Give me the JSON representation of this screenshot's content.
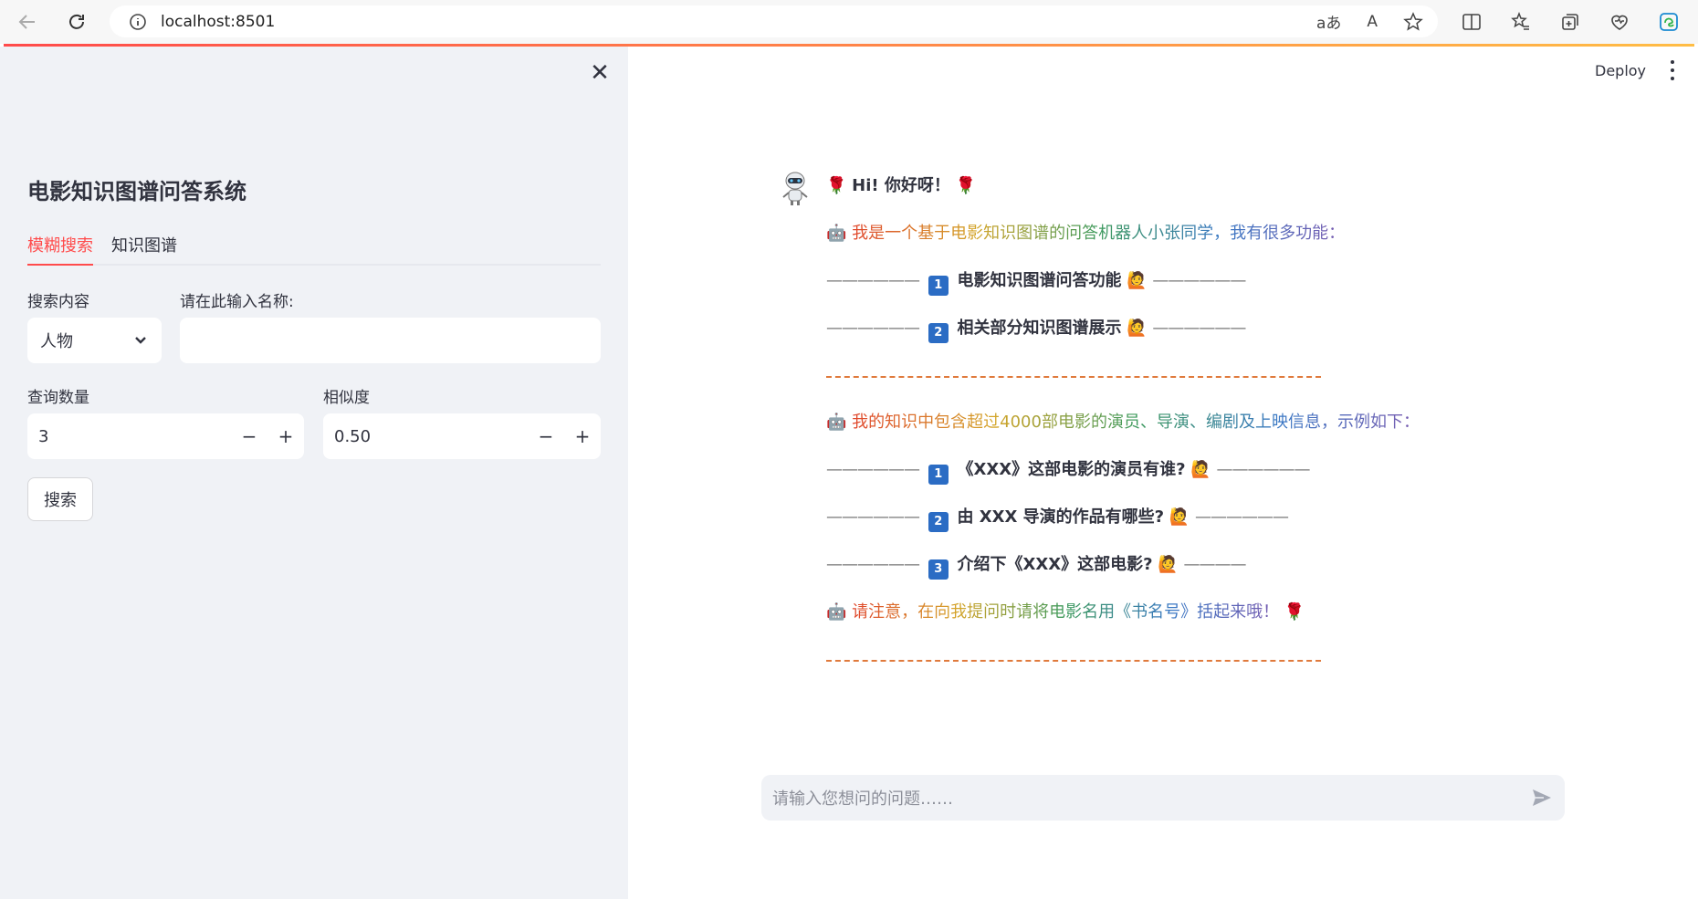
{
  "browser": {
    "url": "localhost:8501",
    "translate_label": "aあ",
    "read_aloud_label": "A"
  },
  "sidebar": {
    "title": "电影知识图谱问答系统",
    "tabs": [
      {
        "label": "模糊搜索",
        "active": true
      },
      {
        "label": "知识图谱",
        "active": false
      }
    ],
    "search_content_label": "搜索内容",
    "search_content_value": "人物",
    "name_label": "请在此输入名称:",
    "name_value": "",
    "count_label": "查询数量",
    "count_value": "3",
    "similarity_label": "相似度",
    "similarity_value": "0.50",
    "search_button": "搜索"
  },
  "header": {
    "deploy_label": "Deploy"
  },
  "chat": {
    "greeting": "Hi! 你好呀！",
    "intro": "我是一个基于电影知识图谱的问答机器人小张同学，我有很多功能：",
    "features": [
      {
        "num": "1",
        "text": "电影知识图谱问答功能"
      },
      {
        "num": "2",
        "text": "相关部分知识图谱展示"
      }
    ],
    "knowledge": "我的知识中包含超过4000部电影的演员、导演、编剧及上映信息，示例如下：",
    "examples": [
      {
        "num": "1",
        "text": "《XXX》这部电影的演员有谁?"
      },
      {
        "num": "2",
        "text": "由 XXX 导演的作品有哪些?"
      },
      {
        "num": "3",
        "text": "介绍下《XXX》这部电影?"
      }
    ],
    "notice": "请注意，在向我提问时请将电影名用《书名号》括起来哦！",
    "dash_short": "——————",
    "dash_4": "————",
    "input_placeholder": "请输入您想问的问题……"
  },
  "colors": {
    "accent": "#ff4b4b",
    "sidebar_bg": "#f0f2f6",
    "text": "#31333f",
    "badge": "#2b6cc4"
  }
}
